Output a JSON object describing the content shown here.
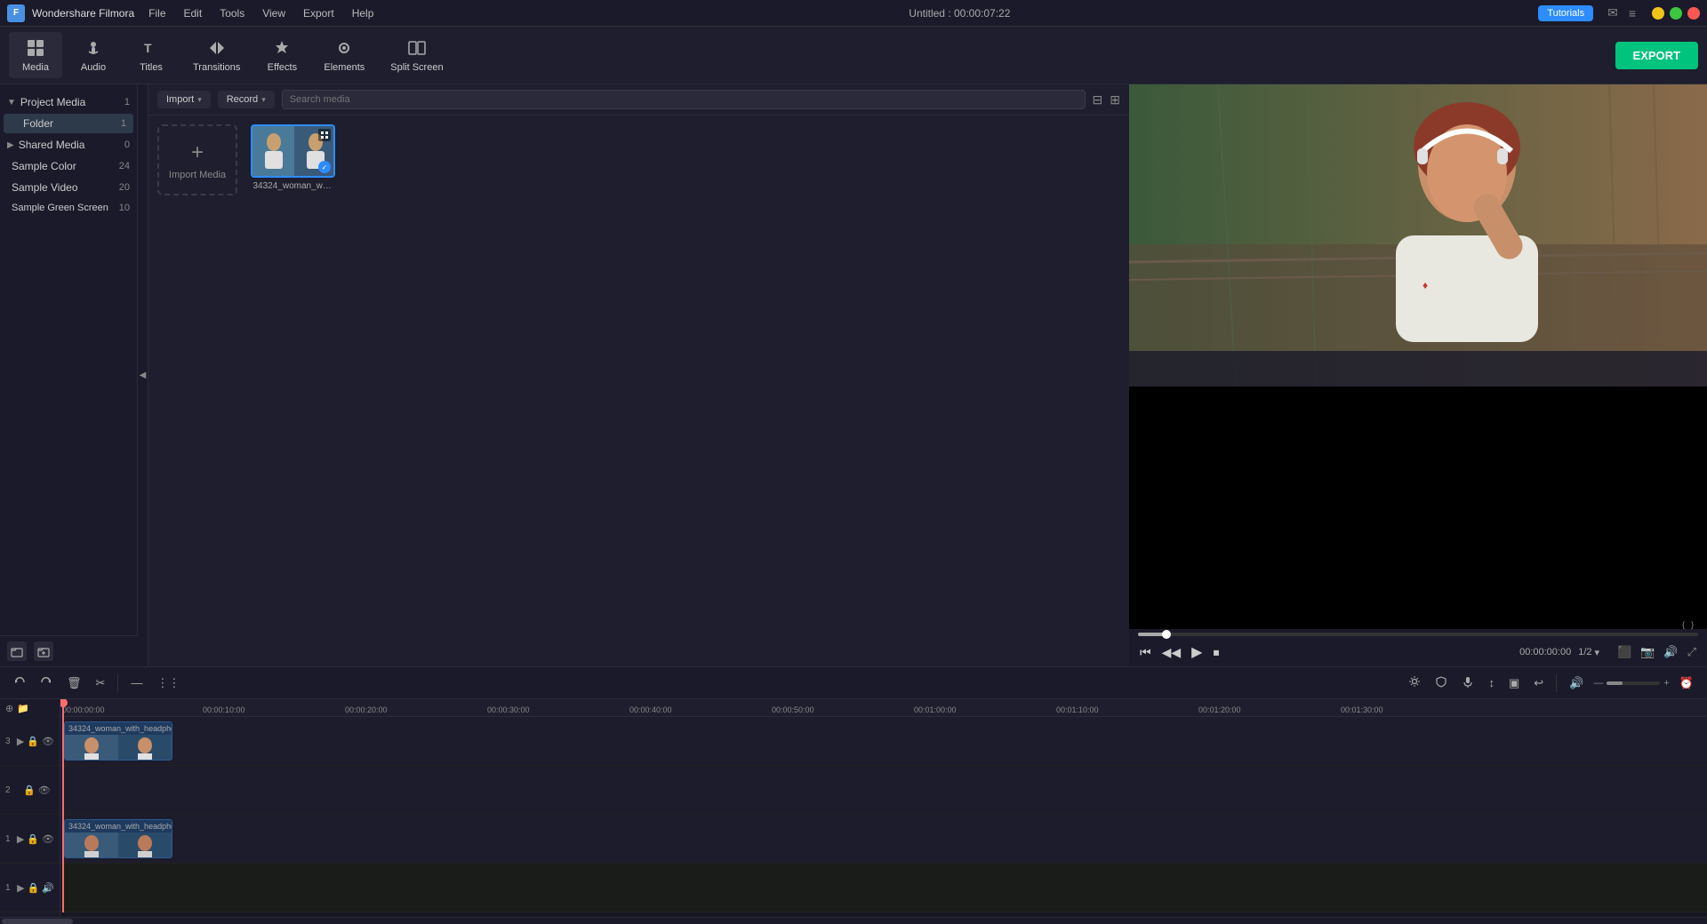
{
  "app": {
    "name": "Wondershare Filmora",
    "logo": "F",
    "title": "Untitled : 00:00:07:22"
  },
  "menu": {
    "items": [
      "File",
      "Edit",
      "Tools",
      "View",
      "Export",
      "Help"
    ]
  },
  "titlebar": {
    "tutorials_label": "Tutorials",
    "minimize": "–",
    "maximize": "□",
    "close": "×"
  },
  "toolbar": {
    "items": [
      {
        "id": "media",
        "icon": "▦",
        "label": "Media"
      },
      {
        "id": "audio",
        "icon": "♪",
        "label": "Audio"
      },
      {
        "id": "titles",
        "icon": "T",
        "label": "Titles"
      },
      {
        "id": "transitions",
        "icon": "⇄",
        "label": "Transitions"
      },
      {
        "id": "effects",
        "icon": "✦",
        "label": "Effects"
      },
      {
        "id": "elements",
        "icon": "◉",
        "label": "Elements"
      },
      {
        "id": "splitscreen",
        "icon": "⊞",
        "label": "Split Screen"
      }
    ],
    "export_label": "EXPORT"
  },
  "left_panel": {
    "sections": [
      {
        "id": "project-media",
        "label": "Project Media",
        "count": 1,
        "expanded": true,
        "items": [
          {
            "id": "folder",
            "label": "Folder",
            "count": 1,
            "active": true
          }
        ]
      },
      {
        "id": "shared-media",
        "label": "Shared Media",
        "count": 0,
        "expanded": false,
        "items": []
      },
      {
        "id": "sample-color",
        "label": "Sample Color",
        "count": 24,
        "expanded": false,
        "items": []
      },
      {
        "id": "sample-video",
        "label": "Sample Video",
        "count": 20,
        "expanded": false,
        "items": []
      },
      {
        "id": "sample-green-screen",
        "label": "Sample Green Screen",
        "count": 10,
        "expanded": false,
        "items": []
      }
    ],
    "bottom_btns": [
      "⊕",
      "📁"
    ]
  },
  "media_toolbar": {
    "import_label": "Import",
    "record_label": "Record",
    "search_placeholder": "Search media",
    "filter_icon": "⊟",
    "grid_icon": "⊞"
  },
  "media_items": [
    {
      "id": "import",
      "type": "import",
      "label": "Import Media"
    },
    {
      "id": "video1",
      "type": "video",
      "name": "34324_woman_with...",
      "thumbnail_color": "#4a6a8a",
      "selected": true
    }
  ],
  "preview": {
    "time": "00:00:00:00",
    "ratio": "1/2",
    "progress_pct": 5
  },
  "playback": {
    "prev_label": "⏮",
    "rewind_label": "◀◀",
    "play_label": "▶",
    "stop_label": "⏹",
    "icons": [
      "⚙",
      "🛡",
      "🎤",
      "↕",
      "▣",
      "↩",
      "—",
      "🔊",
      "✂"
    ]
  },
  "timeline": {
    "tools": [
      "↩",
      "↪",
      "🗑",
      "✂",
      "—",
      "⋮"
    ],
    "right_tools": [
      "⚙",
      "🛡",
      "🎤",
      "↕",
      "▣",
      "↩",
      "—",
      "🔊",
      "✂",
      "⬌"
    ],
    "ruler_marks": [
      "00:00:00:00",
      "00:00:10:00",
      "00:00:20:00",
      "00:00:30:00",
      "00:00:40:00",
      "00:00:50:00",
      "00:01:00:00",
      "00:01:10:00",
      "00:01:20:00",
      "00:01:30:00"
    ],
    "tracks": [
      {
        "num": "3",
        "type": "video",
        "lock": true,
        "eye": true,
        "clip": {
          "label": "34324_woman_with_headpho",
          "start": 0,
          "width": 120
        }
      },
      {
        "num": "2",
        "type": "video",
        "lock": true,
        "eye": true,
        "clip": null
      },
      {
        "num": "1",
        "type": "video",
        "lock": true,
        "eye": true,
        "clip": {
          "label": "34324_woman_with_headpho",
          "start": 0,
          "width": 120
        }
      },
      {
        "num": "1",
        "type": "audio",
        "lock": true,
        "eye": false,
        "clip": null
      }
    ],
    "playhead_pos": 0
  }
}
